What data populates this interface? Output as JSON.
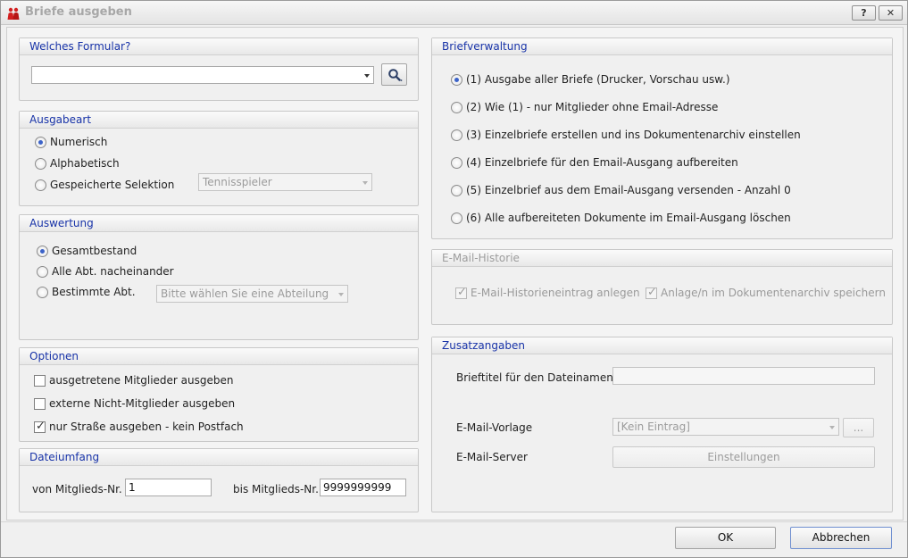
{
  "window": {
    "title": "Briefe ausgeben",
    "help_label": "?",
    "close_label": "✕"
  },
  "formular": {
    "header": "Welches Formular?",
    "value": ""
  },
  "ausgabeart": {
    "header": "Ausgabeart",
    "options": [
      "Numerisch",
      "Alphabetisch",
      "Gespeicherte Selektion"
    ],
    "selected_index": 0,
    "selection_combo": "Tennisspieler"
  },
  "auswertung": {
    "header": "Auswertung",
    "options": [
      "Gesamtbestand",
      "Alle Abt. nacheinander",
      "Bestimmte Abt."
    ],
    "selected_index": 0,
    "abteilung_combo": "Bitte wählen Sie eine Abteilung"
  },
  "optionen": {
    "header": "Optionen",
    "items": [
      {
        "label": "ausgetretene Mitglieder ausgeben",
        "checked": false
      },
      {
        "label": "externe Nicht-Mitglieder ausgeben",
        "checked": false
      },
      {
        "label": "nur Straße ausgeben - kein Postfach",
        "checked": true
      }
    ]
  },
  "dateiumfang": {
    "header": "Dateiumfang",
    "from_label": "von Mitglieds-Nr.",
    "from_value": "1",
    "to_label": "bis Mitglieds-Nr.",
    "to_value": "9999999999"
  },
  "briefverwaltung": {
    "header": "Briefverwaltung",
    "options": [
      "(1) Ausgabe aller Briefe (Drucker, Vorschau usw.)",
      "(2) Wie (1) - nur Mitglieder ohne Email-Adresse",
      "(3) Einzelbriefe erstellen und ins Dokumentenarchiv einstellen",
      "(4) Einzelbriefe für den Email-Ausgang aufbereiten",
      "(5) Einzelbrief aus dem Email-Ausgang versenden - Anzahl 0",
      "(6) Alle aufbereiteten Dokumente im Email-Ausgang löschen"
    ],
    "selected_index": 0
  },
  "historie": {
    "header": "E-Mail-Historie",
    "items": [
      {
        "label": "E-Mail-Historieneintrag anlegen",
        "checked": true
      },
      {
        "label": "Anlage/n im Dokumentenarchiv speichern",
        "checked": true
      }
    ]
  },
  "zusatz": {
    "header": "Zusatzangaben",
    "brieftitel_label": "Brieftitel für den Dateinamen",
    "brieftitel_value": "",
    "vorlage_label": "E-Mail-Vorlage",
    "vorlage_value": "[Kein Eintrag]",
    "browse_label": "...",
    "server_label": "E-Mail-Server",
    "settings_label": "Einstellungen"
  },
  "footer": {
    "ok_label": "OK",
    "cancel_label": "Abbrechen"
  },
  "colors": {
    "header_text": "#1833a8",
    "radio_dot": "#3b62c8"
  }
}
